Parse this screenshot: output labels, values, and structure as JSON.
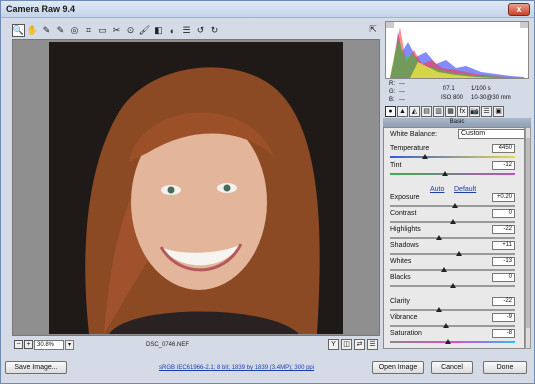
{
  "window": {
    "title": "Camera Raw 9.4",
    "close_label": "x"
  },
  "toolbar": {
    "tools": [
      {
        "name": "zoom-tool-icon",
        "glyph": "🔍",
        "active": true
      },
      {
        "name": "hand-tool-icon",
        "glyph": "✋"
      },
      {
        "name": "white-balance-tool-icon",
        "glyph": "✎"
      },
      {
        "name": "color-sampler-tool-icon",
        "glyph": "✎"
      },
      {
        "name": "targeted-adjustment-tool-icon",
        "glyph": "◎"
      },
      {
        "name": "crop-tool-icon",
        "glyph": "⌗"
      },
      {
        "name": "straighten-tool-icon",
        "glyph": "▭"
      },
      {
        "name": "spot-removal-tool-icon",
        "glyph": "✂"
      },
      {
        "name": "red-eye-tool-icon",
        "glyph": "⊙"
      },
      {
        "name": "adjustment-brush-icon",
        "glyph": "🖌"
      },
      {
        "name": "graduated-filter-icon",
        "glyph": "◧"
      },
      {
        "name": "radial-filter-icon",
        "glyph": "◐"
      },
      {
        "name": "preferences-icon",
        "glyph": "☰"
      },
      {
        "name": "rotate-left-icon",
        "glyph": "↺"
      },
      {
        "name": "rotate-right-icon",
        "glyph": "↻"
      }
    ],
    "fullscreen_glyph": "⇱"
  },
  "statusbar": {
    "zoom_out_glyph": "−",
    "zoom_in_glyph": "+",
    "zoom_value": "30.8%",
    "zoom_dropdown_glyph": "▾",
    "filename": "DSC_0746.NEF",
    "view_buttons": [
      "Y",
      "◫",
      "⇄",
      "☰"
    ]
  },
  "readout": {
    "r": "R:",
    "g": "G:",
    "b": "B:",
    "r_val": "---",
    "g_val": "---",
    "b_val": "---",
    "aperture": "f/7.1",
    "shutter": "1/100 s",
    "iso": "ISO 800",
    "lens": "10-30@30 mm"
  },
  "panel_tabs": [
    "●",
    "▲",
    "◭",
    "▤",
    "▥",
    "▦",
    "fx",
    "📷",
    "☰",
    "▣"
  ],
  "basic": {
    "header": "Basic",
    "white_balance_label": "White Balance:",
    "white_balance_value": "Custom",
    "auto_label": "Auto",
    "default_label": "Default",
    "sliders": [
      {
        "key": "temperature",
        "label": "Temperature",
        "value": "4450",
        "pos": 0.28,
        "track": "temp"
      },
      {
        "key": "tint",
        "label": "Tint",
        "value": "-12",
        "pos": 0.44,
        "track": "tint"
      },
      {
        "key": "exposure",
        "label": "Exposure",
        "value": "+0.20",
        "pos": 0.52
      },
      {
        "key": "contrast",
        "label": "Contrast",
        "value": "0",
        "pos": 0.5
      },
      {
        "key": "highlights",
        "label": "Highlights",
        "value": "-22",
        "pos": 0.39
      },
      {
        "key": "shadows",
        "label": "Shadows",
        "value": "+11",
        "pos": 0.55
      },
      {
        "key": "whites",
        "label": "Whites",
        "value": "-13",
        "pos": 0.43
      },
      {
        "key": "blacks",
        "label": "Blacks",
        "value": "0",
        "pos": 0.5
      },
      {
        "key": "clarity",
        "label": "Clarity",
        "value": "-22",
        "pos": 0.39
      },
      {
        "key": "vibrance",
        "label": "Vibrance",
        "value": "-9",
        "pos": 0.45
      },
      {
        "key": "saturation",
        "label": "Saturation",
        "value": "-8",
        "pos": 0.46,
        "track": "sat"
      }
    ]
  },
  "bottom": {
    "save_label": "Save Image...",
    "info_text": "sRGB IEC61966-2.1; 8 bit; 1839 by 1839 (3.4MP); 300 ppi",
    "open_label": "Open Image",
    "cancel_label": "Cancel",
    "done_label": "Done"
  },
  "colors": {
    "accent_link": "#1a3fa8",
    "photo_background": "#1f1a17",
    "hair": "#a0522d"
  }
}
